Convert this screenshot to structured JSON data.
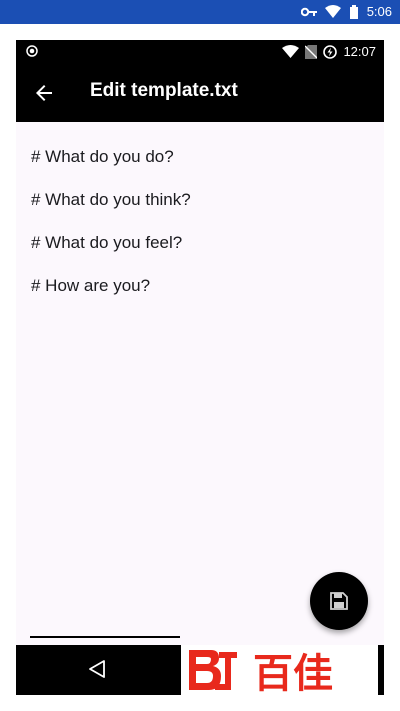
{
  "host_status": {
    "time": "5:06"
  },
  "device_status": {
    "time": "12:07"
  },
  "appbar": {
    "title": "Edit template.txt"
  },
  "editor": {
    "lines": [
      "# What do you do?",
      "# What do you think?",
      "# What do you feel?",
      "# How are you?"
    ]
  },
  "icons": {
    "back": "arrow-left-icon",
    "save": "floppy-disk-icon",
    "nav_back": "triangle-back-icon"
  },
  "colors": {
    "host_status_bar": "#1b4fb4",
    "app_bar": "#000000",
    "editor_bg": "#fcf8fd",
    "watermark": "#e8291c"
  },
  "watermark": {
    "text": "百佳"
  }
}
